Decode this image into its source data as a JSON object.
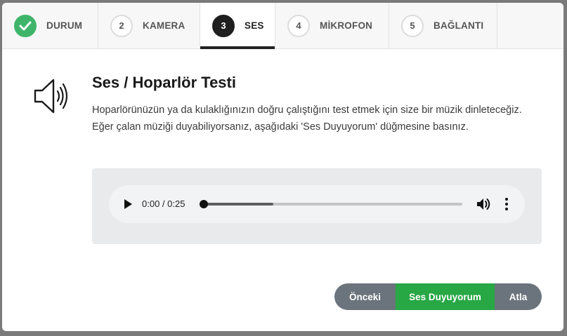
{
  "steps": [
    {
      "number": "",
      "label": "DURUM",
      "state": "done",
      "icon": "check-icon"
    },
    {
      "number": "2",
      "label": "KAMERA",
      "state": "pending"
    },
    {
      "number": "3",
      "label": "SES",
      "state": "active"
    },
    {
      "number": "4",
      "label": "MİKROFON",
      "state": "pending"
    },
    {
      "number": "5",
      "label": "BAĞLANTI",
      "state": "pending"
    }
  ],
  "content": {
    "icon": "speaker-icon",
    "title": "Ses / Hoparlör Testi",
    "description": "Hoparlörünüzün ya da kulaklığınızın doğru çalıştığını test etmek için size bir müzik dinleteceğiz. Eğer çalan müziği duyabiliyorsanız, aşağıdaki 'Ses Duyuyorum' düğmesine basınız."
  },
  "player": {
    "current_time": "0:00",
    "separator": " / ",
    "duration": "0:25",
    "progress": 0,
    "buffered": 0.27,
    "play_icon": "play-icon",
    "volume_icon": "volume-icon",
    "menu_icon": "more-vertical-icon"
  },
  "buttons": {
    "previous": "Önceki",
    "confirm": "Ses Duyuyorum",
    "skip": "Atla"
  },
  "colors": {
    "done": "#3fb56b",
    "active": "#1f1f1f",
    "confirm_button": "#28a745",
    "secondary_button": "#6b747c"
  }
}
